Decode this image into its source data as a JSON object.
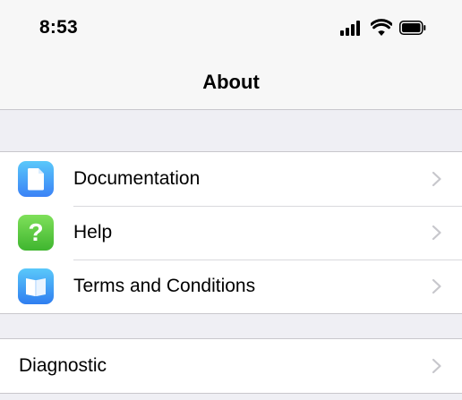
{
  "status_bar": {
    "time": "8:53",
    "icons": [
      "signal-icon",
      "wifi-icon",
      "battery-icon"
    ]
  },
  "nav": {
    "title": "About"
  },
  "about_group": {
    "items": [
      {
        "label": "Documentation",
        "icon": "document-icon",
        "color": "#4aa3f5"
      },
      {
        "label": "Help",
        "icon": "question-mark-icon",
        "glyph": "?",
        "color": "#4cc83a"
      },
      {
        "label": "Terms and Conditions",
        "icon": "book-icon",
        "color": "#3f8ff2"
      }
    ]
  },
  "diagnostic_group": {
    "items": [
      {
        "label": "Diagnostic"
      }
    ]
  },
  "colors": {
    "background": "#efeff4",
    "separator": "#c8c7cc",
    "chevron": "#c7c7cc"
  }
}
